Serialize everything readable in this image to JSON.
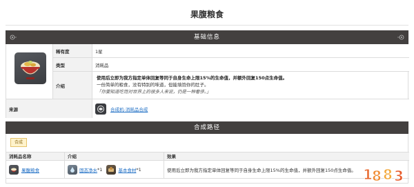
{
  "page": {
    "title": "果腹粮食"
  },
  "basic_info": {
    "header": "基础信息",
    "rows": [
      {
        "label": "稀有度",
        "value": "1星"
      },
      {
        "label": "类型",
        "value": "消耗品"
      }
    ],
    "intro_label": "介绍",
    "intro_effect": "使用后立即为我方指定单体回复等同于自身生命上限15%的生命值，并额外回复150点生命值。",
    "intro_text": "一份简单的粮食，没有特别的味道，但能填饱你的肚子。",
    "intro_quote": "「你要知道吃饱对世界上的很多人来说，仍是一种奢侈。」",
    "source_label": "来源",
    "source_link": "合成机-消耗品合成",
    "source_icon": "synthesizer-icon"
  },
  "recipe": {
    "header": "合成路径",
    "tag": "合成",
    "columns": [
      "消耗品名称",
      "介绍",
      "效果"
    ],
    "row": {
      "name": "果腹粮食",
      "materials": [
        {
          "name": "固态净水",
          "count": "*1"
        },
        {
          "name": "基本食材",
          "count": "*1"
        }
      ],
      "effect": "使用后立即为我方指定单体回复等同于自身生命上限15%的生命值，并额外回复150点生命值。"
    }
  },
  "watermark": {
    "icon": "1883-logo-icon"
  },
  "colors": {
    "header_bg": "#43403f",
    "label_bg": "#f2f2f2",
    "link": "#1f6fc5",
    "tag_bg": "#fff3cc",
    "border": "#dcdcdc"
  }
}
